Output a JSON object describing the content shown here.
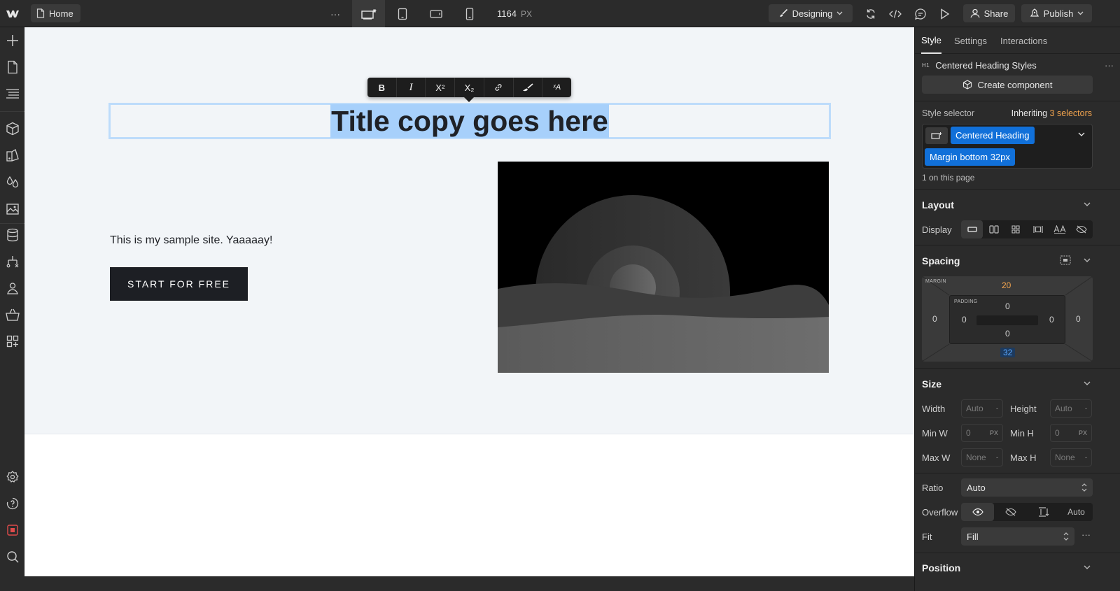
{
  "topbar": {
    "page_label": "Home",
    "more_label": "···",
    "width_value": "1164",
    "width_unit": "PX",
    "mode_label": "Designing",
    "share_label": "Share",
    "publish_label": "Publish"
  },
  "canvas": {
    "heading": "Title copy goes here",
    "body": "This is my sample site. Yaaaaay!",
    "cta": "START FOR FREE",
    "rt_toolbar": [
      "B",
      "I",
      "X²",
      "X₂",
      "link",
      "brush",
      "ˣA"
    ]
  },
  "panel": {
    "tabs": [
      "Style",
      "Settings",
      "Interactions"
    ],
    "element_tag": "H1",
    "element_name": "Centered Heading Styles",
    "create_component": "Create component",
    "style_selector_label": "Style selector",
    "inheriting_prefix": "Inheriting",
    "inheriting_count": "3 selectors",
    "chips": [
      "Centered Heading",
      "Margin bottom 32px"
    ],
    "on_page": "1 on this page",
    "layout": {
      "title": "Layout",
      "display_label": "Display"
    },
    "spacing": {
      "title": "Spacing",
      "margin_label": "MARGIN",
      "padding_label": "PADDING",
      "margin": {
        "top": "20",
        "right": "0",
        "bottom": "32",
        "left": "0"
      },
      "padding": {
        "top": "0",
        "right": "0",
        "bottom": "0",
        "left": "0"
      }
    },
    "size": {
      "title": "Size",
      "width_label": "Width",
      "width_value": "Auto",
      "width_unit": "-",
      "height_label": "Height",
      "height_value": "Auto",
      "height_unit": "-",
      "minw_label": "Min W",
      "minw_value": "0",
      "minw_unit": "PX",
      "minh_label": "Min H",
      "minh_value": "0",
      "minh_unit": "PX",
      "maxw_label": "Max W",
      "maxw_value": "None",
      "maxw_unit": "-",
      "maxh_label": "Max H",
      "maxh_value": "None",
      "maxh_unit": "-"
    },
    "ratio_label": "Ratio",
    "ratio_value": "Auto",
    "overflow_label": "Overflow",
    "overflow_auto": "Auto",
    "fit_label": "Fit",
    "fit_value": "Fill",
    "position_title": "Position"
  },
  "colors": {
    "accent": "#1170d9",
    "inherit_highlight": "#f2a44e",
    "selection": "#a7d0fb",
    "cta_bg": "#1d1f24"
  }
}
